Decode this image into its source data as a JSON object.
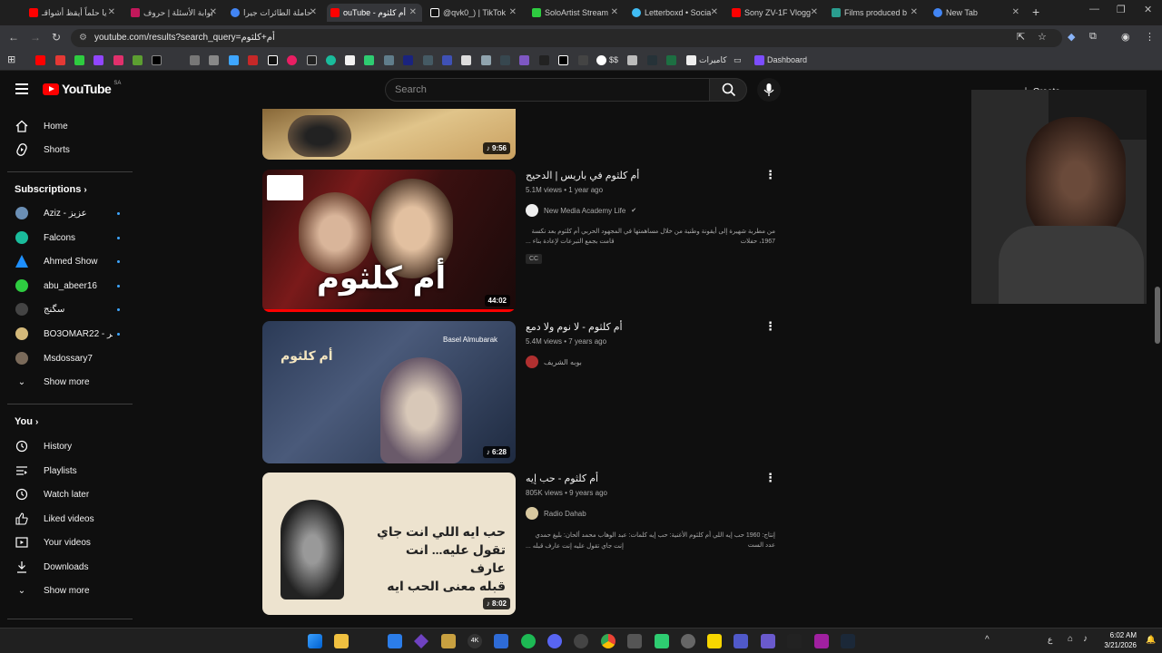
{
  "browser": {
    "tabs": [
      {
        "label": "يا حلماً أيقظ أشواقـ",
        "color": "#ff0000",
        "active": false
      },
      {
        "label": "بوابة الأسئلة | حروف",
        "color": "#c2185b",
        "active": false
      },
      {
        "label": "حاملة الطائرات جيرا",
        "color": "#4285f4",
        "active": false
      },
      {
        "label": "ouTube - أم كلثوم",
        "color": "#ff0000",
        "active": true
      },
      {
        "label": "@qvk0_) | TikTok",
        "color": "#111111",
        "active": false
      },
      {
        "label": "SoloArtist Stream",
        "color": "#2ecc40",
        "active": false
      },
      {
        "label": "Letterboxd • Socia",
        "color": "#40bcf4",
        "active": false
      },
      {
        "label": "Sony ZV-1F Vlogg",
        "color": "#ff0000",
        "active": false
      },
      {
        "label": "Films produced b",
        "color": "#2a9d8f",
        "active": false
      },
      {
        "label": "New Tab",
        "color": "#4285f4",
        "active": false
      }
    ],
    "url": "youtube.com/results?search_query=أم+كلثوم",
    "bookmarks": {
      "cameras_label": "كاميرات",
      "dashboard_label": "Dashboard",
      "dollar_label": "$$"
    }
  },
  "youtube": {
    "logo_text": "YouTube",
    "logo_region": "SA",
    "search_placeholder": "Search",
    "create_label": "Create",
    "sidebar": {
      "home": "Home",
      "shorts": "Shorts",
      "subscriptions_header": "Subscriptions",
      "subscriptions": [
        {
          "name": "Aziz - عزيز",
          "color": "#6b8fb5"
        },
        {
          "name": "Falcons",
          "color": "#1abc9c"
        },
        {
          "name": "Ahmed Show",
          "color": "#1e90ff"
        },
        {
          "name": "abu_abeer16",
          "color": "#2ecc40"
        },
        {
          "name": "سگنج",
          "color": "#444444"
        },
        {
          "name": "BO3OMAR22 - بو عمر",
          "color": "#d4b97a"
        },
        {
          "name": "Msdossary7",
          "color": "#7a6a5a"
        }
      ],
      "show_more_1": "Show more",
      "you_header": "You",
      "you_items": [
        "History",
        "Playlists",
        "Watch later",
        "Liked videos",
        "Your videos",
        "Downloads"
      ],
      "show_more_2": "Show more"
    },
    "results": [
      {
        "title": "",
        "duration": "9:56"
      },
      {
        "title": "أم كلثوم في باريس | الدحيح",
        "views": "5.1M views",
        "age": "1 year ago",
        "channel": "New Media Academy Life",
        "verified": "✔",
        "description_1": "من مطربة شهيرة إلى أيقونة وطنية من خلال مساهمتها في المجهود الحربي أم كلثوم بعد نكسة 1967، حفلات",
        "description_2": "قامت بجمع التبرعات لإعادة بناء ...",
        "badge": "CC",
        "duration": "44:02"
      },
      {
        "title": "أم كلثوم - لا نوم ولا دمع",
        "views": "5.4M views",
        "age": "7 years ago",
        "channel": "بوبه الشريف",
        "duration": "6:28",
        "watermark": "Basel Almubarak"
      },
      {
        "title": "أم كلثوم - حب إيه",
        "views": "805K views",
        "age": "9 years ago",
        "channel": "Radio Dahab",
        "description_1": "إنتاج: 1960 حب إيه اللي أم كلثوم الأغنية: حب إيه كلمات: عبد الوهاب محمد ألحان: بليغ حمدي عدد الست",
        "description_2": "إنت جاي تقول عليه إنت عارف قبله ...",
        "duration": "8:02"
      }
    ]
  },
  "taskbar": {
    "time": "6:02 AM",
    "date": "3/21/2026"
  }
}
